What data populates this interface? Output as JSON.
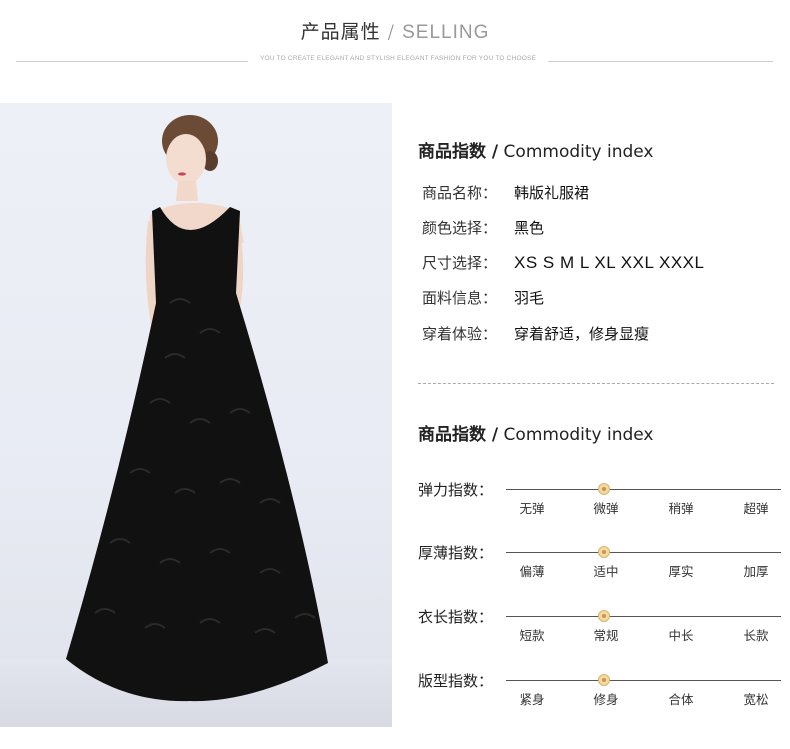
{
  "header": {
    "title_cn": "产品属性",
    "title_sep": "/",
    "title_en": "SELLING",
    "tagline": "YOU TO CREATE ELEGANT AND STYLISH ELEGANT FASHION FOR YOU TO CHOOSE"
  },
  "section1": {
    "title_bold": "商品指数 /",
    "title_en": "Commodity index",
    "rows": [
      {
        "label": "商品名称：",
        "value": "韩版礼服裙"
      },
      {
        "label": "颜色选择：",
        "value": "黑色"
      },
      {
        "label": "尺寸选择：",
        "value": "XS S M L XL XXL XXXL"
      },
      {
        "label": "面料信息：",
        "value": "羽毛"
      },
      {
        "label": "穿着体验：",
        "value": "穿着舒适，修身显瘦"
      }
    ]
  },
  "section2": {
    "title_bold": "商品指数 /",
    "title_en": "Commodity index",
    "scales": [
      {
        "label": "弹力指数：",
        "options": [
          "无弹",
          "微弹",
          "稍弹",
          "超弹"
        ],
        "selected_index": 1
      },
      {
        "label": "厚薄指数：",
        "options": [
          "偏薄",
          "适中",
          "厚实",
          "加厚"
        ],
        "selected_index": 1
      },
      {
        "label": "衣长指数：",
        "options": [
          "短款",
          "常规",
          "中长",
          "长款"
        ],
        "selected_index": 1
      },
      {
        "label": "版型指数：",
        "options": [
          "紧身",
          "修身",
          "合体",
          "宽松"
        ],
        "selected_index": 1
      }
    ]
  },
  "colors": {
    "dress": "#111111",
    "marker": "#d8b573"
  }
}
